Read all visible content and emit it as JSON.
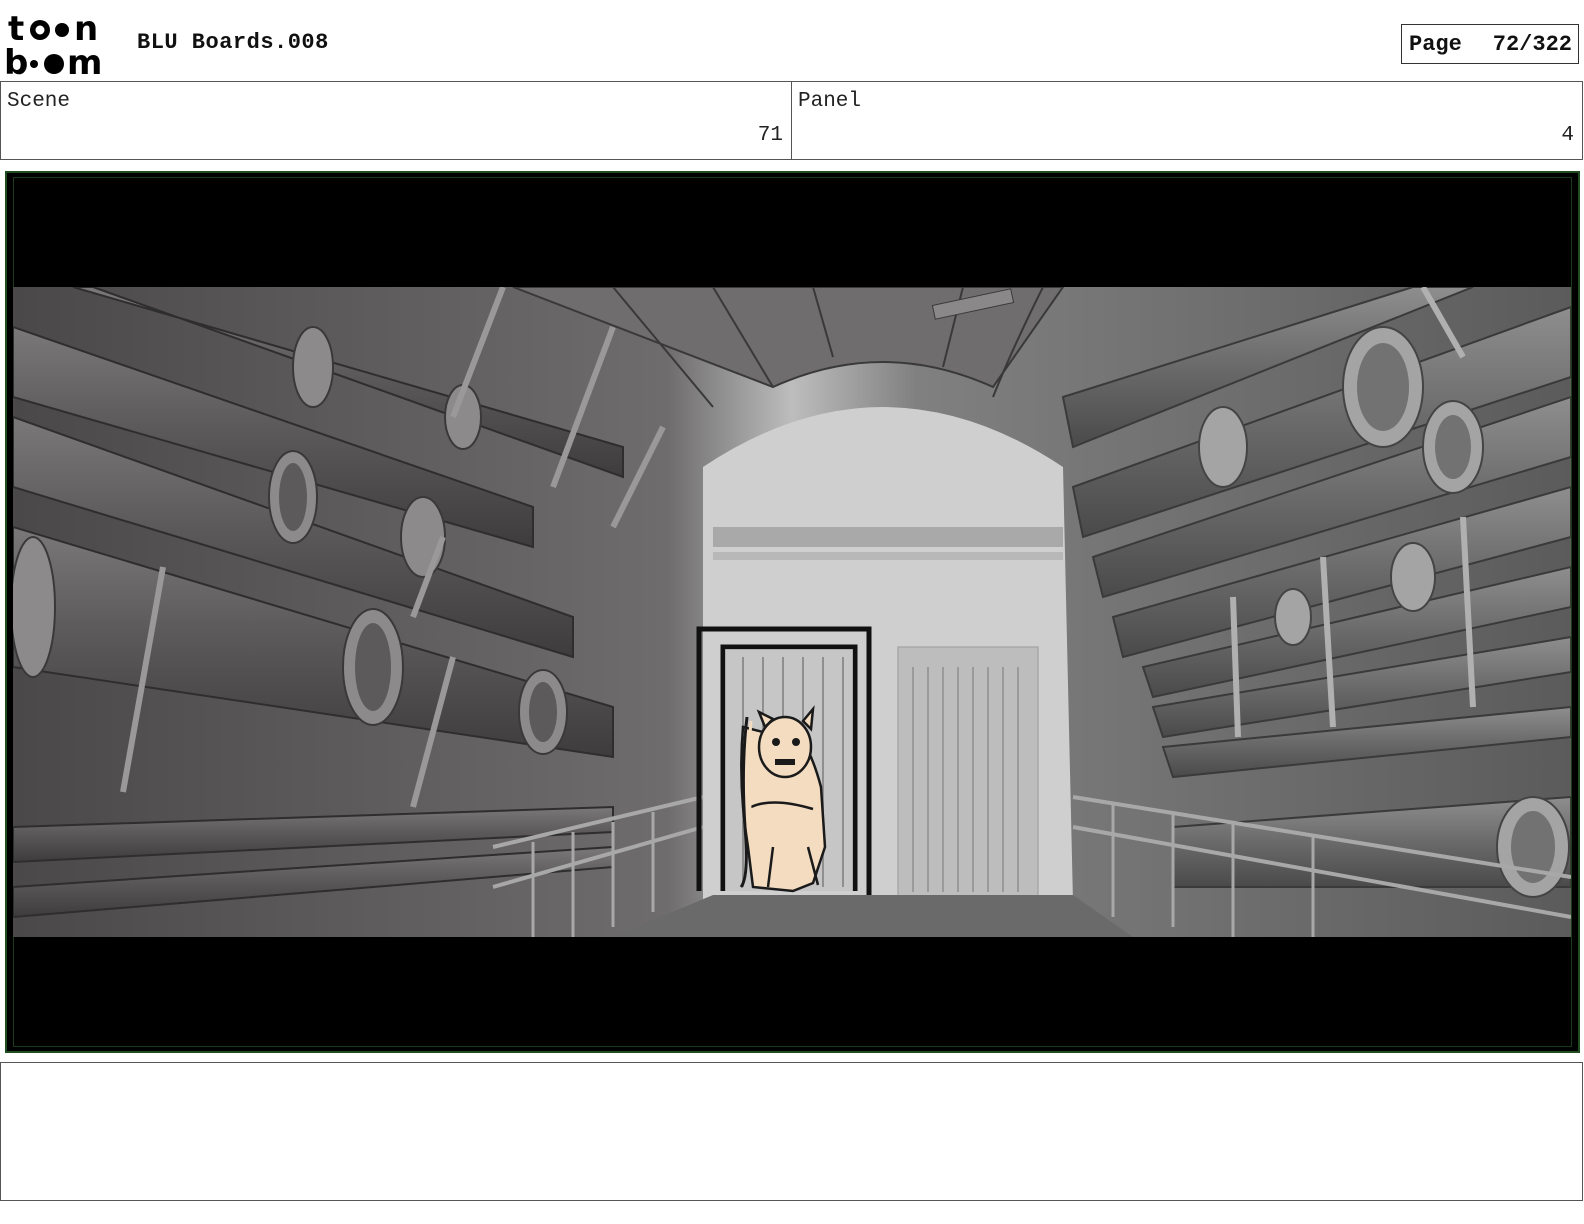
{
  "app": {
    "logo_text_top": "to•n",
    "logo_text_bottom": "b••m",
    "document_title": "BLU Boards.008"
  },
  "page": {
    "label": "Page",
    "number": "72/322"
  },
  "info": {
    "scene_label": "Scene",
    "scene_value": "71",
    "panel_label": "Panel",
    "panel_value": "4"
  },
  "notes": {
    "text": ""
  }
}
